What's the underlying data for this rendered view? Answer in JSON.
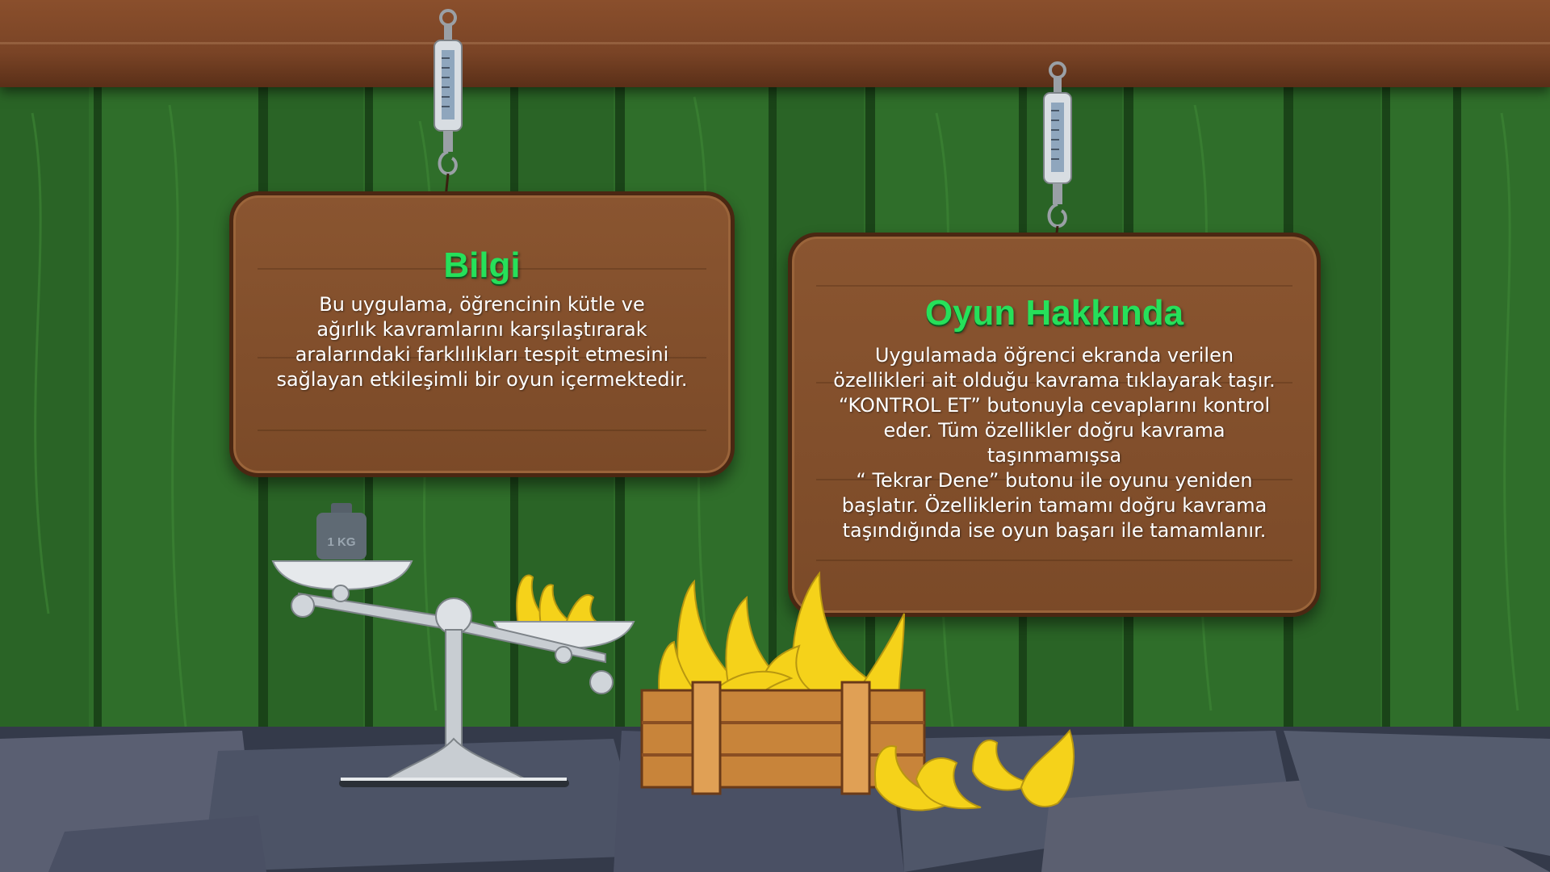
{
  "info_board": {
    "title": "Bilgi",
    "text": "Bu uygulama, öğrencinin kütle ve\nağırlık kavramlarını karşılaştırarak\naralarındaki farklılıkları tespit etmesini\nsağlayan etkileşimli bir oyun içermektedir."
  },
  "about_board": {
    "title": "Oyun Hakkında",
    "text": "Uygulamada öğrenci ekranda verilen\nözellikleri ait olduğu kavrama tıklayarak taşır.\n“KONTROL ET” butonuyla cevaplarını kontrol\neder.  Tüm özellikler doğru kavrama taşınmamışsa\n“ Tekrar Dene” butonu ile oyunu yeniden\nbaşlatır. Özelliklerin tamamı doğru kavrama\ntaşındığında ise oyun başarı ile tamamlanır."
  },
  "weight_label": "1 KG",
  "colors": {
    "background_green": "#2f6e2a",
    "board_brown": "#7b4a28",
    "title_green": "#26e05a",
    "banana_yellow": "#f5d21a",
    "stone_gray": "#4c5366"
  }
}
